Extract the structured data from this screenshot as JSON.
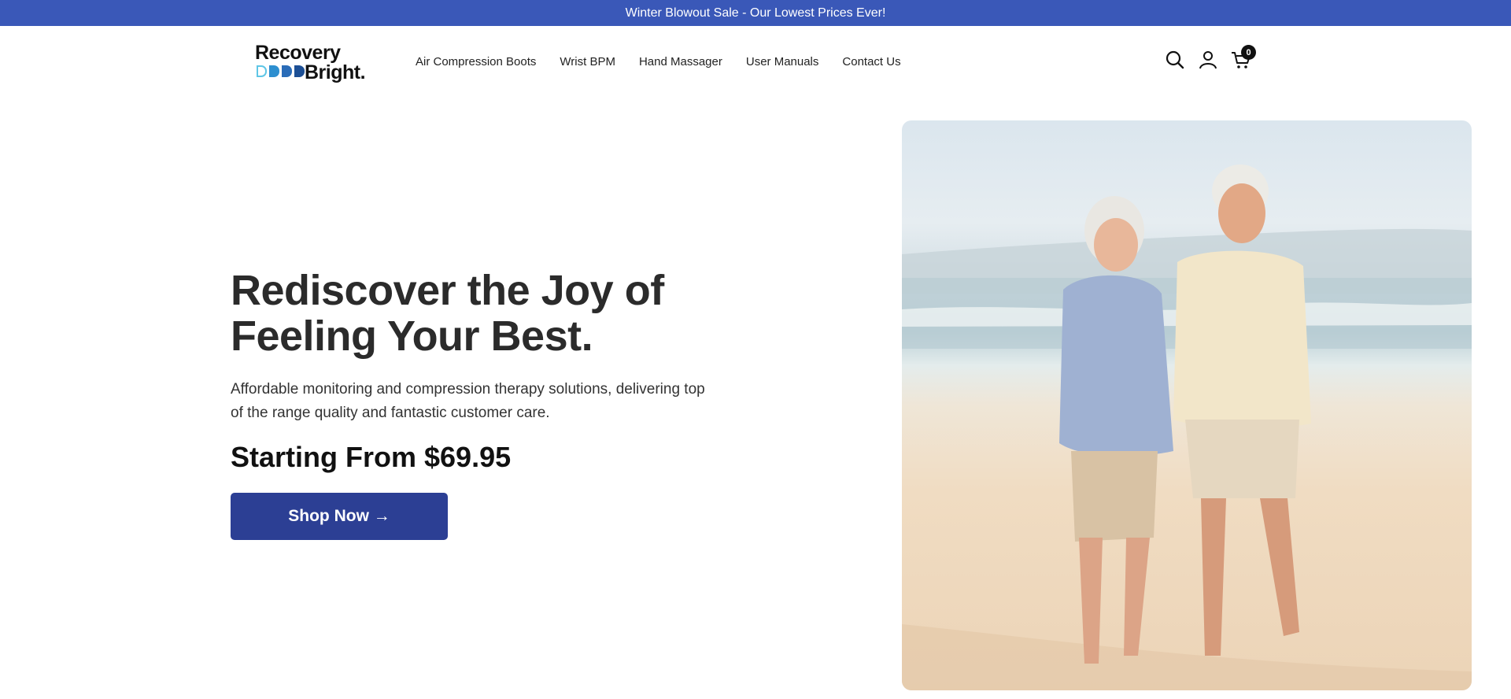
{
  "announcement": {
    "text": "Winter Blowout Sale - Our Lowest Prices Ever!"
  },
  "header": {
    "logo": {
      "line1": "Recovery",
      "line2": "Bright.",
      "block_colors": [
        "#5fc6e6",
        "#2d8fd0",
        "#2a6cb8",
        "#1c4f95"
      ]
    },
    "nav": [
      {
        "label": "Air Compression Boots"
      },
      {
        "label": "Wrist BPM"
      },
      {
        "label": "Hand Massager"
      },
      {
        "label": "User Manuals"
      },
      {
        "label": "Contact Us"
      }
    ],
    "icons": {
      "search": "search-icon",
      "account": "user-icon",
      "cart": "cart-icon"
    },
    "cart_count": "0"
  },
  "hero": {
    "title": "Rediscover the Joy of Feeling Your Best.",
    "subtitle": "Affordable monitoring and compression therapy solutions, delivering top of the range quality and fantastic customer care.",
    "price_line": "Starting From $69.95",
    "cta_label": "Shop Now →",
    "image_alt": "Senior couple walking on beach"
  },
  "colors": {
    "announcement_bg": "#3a58b8",
    "cta_bg": "#2c3f94"
  }
}
